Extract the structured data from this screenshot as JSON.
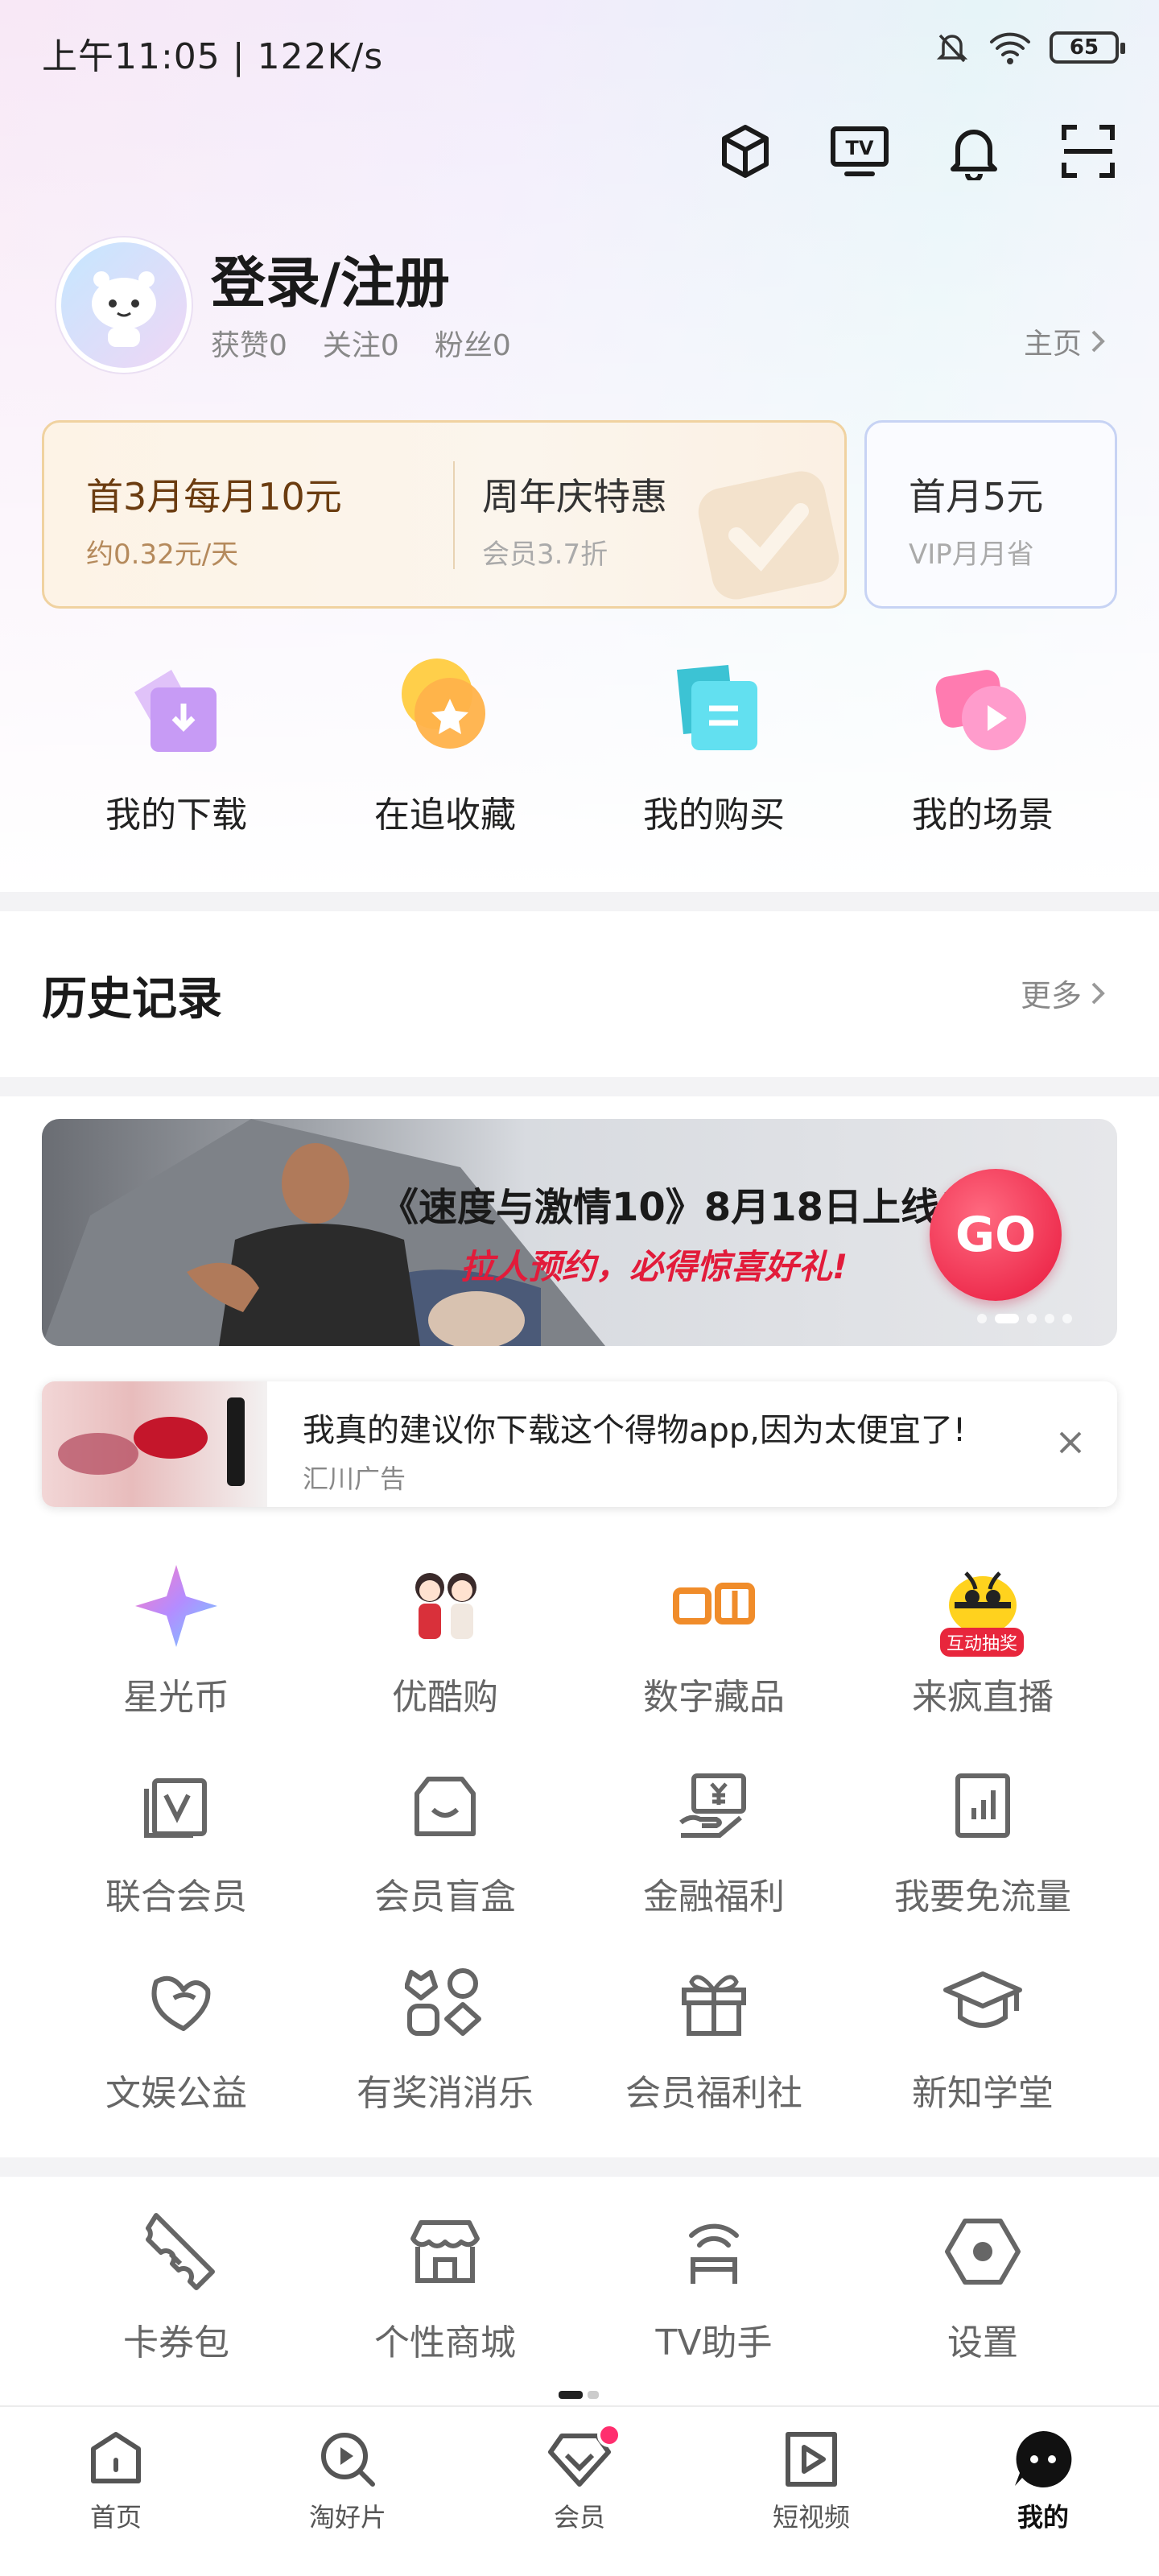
{
  "status_bar": {
    "time": "上午11:05 | 122K/s",
    "battery": "65"
  },
  "profile": {
    "login_label": "登录/注册",
    "likes": "获赞0",
    "following": "关注0",
    "fans": "粉丝0",
    "homepage": "主页"
  },
  "vip": {
    "offer1_title": "首3月每月10元",
    "offer1_sub": "约0.32元/天",
    "offer2_title": "周年庆特惠",
    "offer2_sub": "会员3.7折",
    "offer3_title": "首月5元",
    "offer3_sub": "VIP月月省"
  },
  "quick": [
    {
      "label": "我的下载"
    },
    {
      "label": "在追收藏"
    },
    {
      "label": "我的购买"
    },
    {
      "label": "我的场景"
    }
  ],
  "history": {
    "title": "历史记录",
    "more": "更多"
  },
  "banner": {
    "line1": "《速度与激情10》8月18日上线!",
    "line2": "拉人预约，必得惊喜好礼!",
    "go": "GO"
  },
  "ad": {
    "text": "我真的建议你下载这个得物app,因为太便宜了!",
    "source": "汇川广告"
  },
  "services_row1": [
    {
      "label": "星光币"
    },
    {
      "label": "优酷购"
    },
    {
      "label": "数字藏品"
    },
    {
      "label": "来疯直播",
      "badge": "互动抽奖"
    }
  ],
  "services_row2": [
    {
      "label": "联合会员"
    },
    {
      "label": "会员盲盒"
    },
    {
      "label": "金融福利"
    },
    {
      "label": "我要免流量"
    }
  ],
  "services_row3": [
    {
      "label": "文娱公益"
    },
    {
      "label": "有奖消消乐"
    },
    {
      "label": "会员福利社"
    },
    {
      "label": "新知学堂"
    }
  ],
  "tools": [
    {
      "label": "卡券包"
    },
    {
      "label": "个性商城"
    },
    {
      "label": "TV助手"
    },
    {
      "label": "设置"
    }
  ],
  "tabs": [
    {
      "label": "首页"
    },
    {
      "label": "淘好片"
    },
    {
      "label": "会员"
    },
    {
      "label": "短视频"
    },
    {
      "label": "我的"
    }
  ],
  "brand": {
    "vip_gold": "#6b3c10",
    "accent_red": "#e8173c",
    "active_tab": "#111111"
  }
}
